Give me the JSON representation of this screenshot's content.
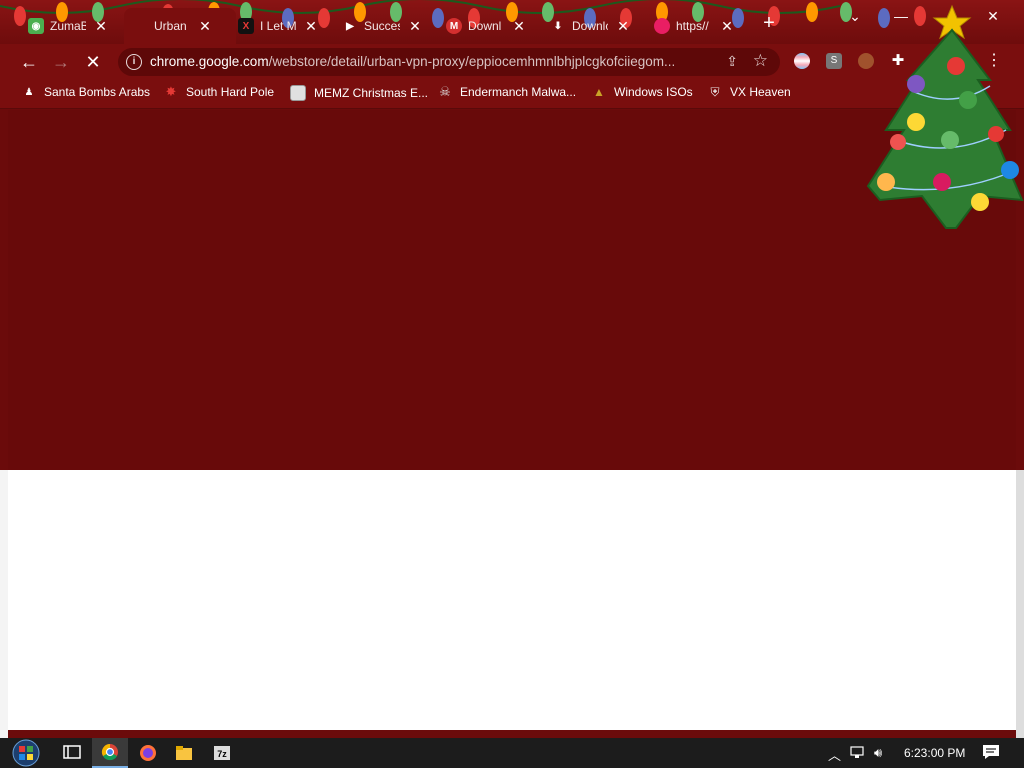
{
  "tabs": [
    {
      "title": "ZumaB",
      "favicon": "santa-favicon",
      "active": false
    },
    {
      "title": "Urban",
      "favicon": "loading-favicon",
      "active": true
    },
    {
      "title": "I Let M",
      "favicon": "x-favicon",
      "active": false
    },
    {
      "title": "Succes",
      "favicon": "play-favicon",
      "active": false
    },
    {
      "title": "Downl",
      "favicon": "mega-favicon",
      "active": false
    },
    {
      "title": "Downlc",
      "favicon": "download-favicon",
      "active": false
    },
    {
      "title": "https//",
      "favicon": "pink-favicon",
      "active": false
    }
  ],
  "toolbar": {
    "url_host": "chrome.google.com",
    "url_path": "/webstore/detail/urban-vpn-proxy/eppiocemhmnlbhjplcgkofciiegom..."
  },
  "bookmarks": [
    {
      "label": "Santa Bombs Arabs",
      "icon": "santa-icon"
    },
    {
      "label": "South Hard Pole",
      "icon": "red-star-icon"
    },
    {
      "label": "MEMZ Christmas E...",
      "icon": "image-icon"
    },
    {
      "label": "Endermanch Malwa...",
      "icon": "skull-icon"
    },
    {
      "label": "Windows ISOs",
      "icon": "box-icon"
    },
    {
      "label": "VX Heaven",
      "icon": "shield-icon"
    }
  ],
  "taskbar": {
    "clock": "6:23:00 PM"
  },
  "colors": {
    "page_dark": "#680a0a",
    "chrome_frame": "#7a0e0e",
    "taskbar": "#1c1c1c"
  }
}
